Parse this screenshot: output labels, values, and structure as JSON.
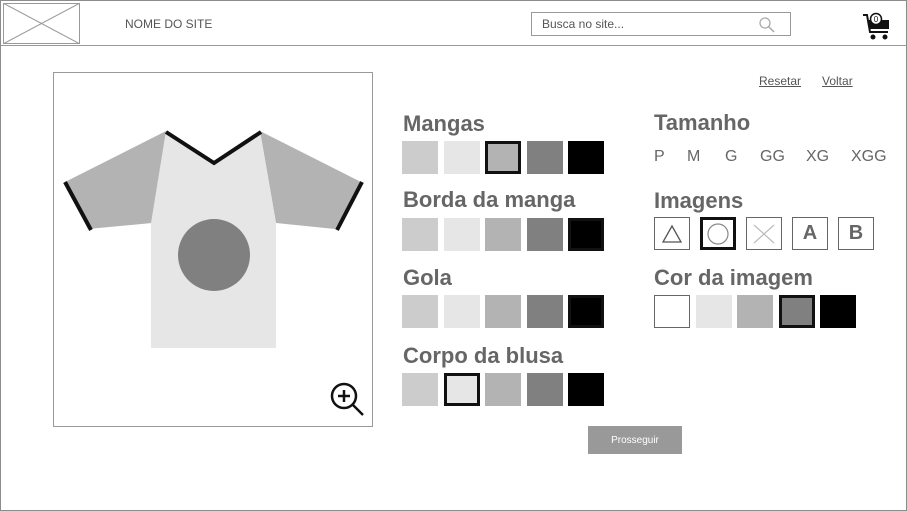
{
  "header": {
    "site_name": "NOME DO SITE",
    "search_placeholder": "Busca no site...",
    "cart_count": "0"
  },
  "links": {
    "reset": "Resetar",
    "back": "Voltar"
  },
  "preview": {
    "colors": {
      "sleeves": "#b3b3b3",
      "sleeve_border": "#111111",
      "collar": "#111111",
      "body": "#e6e6e6",
      "image": "#808080"
    }
  },
  "options": {
    "sleeves": {
      "title": "Mangas",
      "swatches": [
        "#cccccc",
        "#e6e6e6",
        "#b3b3b3",
        "#808080",
        "#000000"
      ],
      "selected": 2
    },
    "sleeve_border": {
      "title": "Borda da manga",
      "swatches": [
        "#cccccc",
        "#e6e6e6",
        "#b3b3b3",
        "#808080",
        "#000000"
      ],
      "selected": 4
    },
    "collar": {
      "title": "Gola",
      "swatches": [
        "#cccccc",
        "#e6e6e6",
        "#b3b3b3",
        "#808080",
        "#000000"
      ],
      "selected": 4
    },
    "body": {
      "title": "Corpo da blusa",
      "swatches": [
        "#cccccc",
        "#e6e6e6",
        "#b3b3b3",
        "#808080",
        "#000000"
      ],
      "selected": 1
    },
    "size": {
      "title": "Tamanho",
      "values": [
        "P",
        "M",
        "G",
        "GG",
        "XG",
        "XGG"
      ]
    },
    "images": {
      "title": "Imagens",
      "items": [
        {
          "icon": "triangle-icon",
          "label": ""
        },
        {
          "icon": "circle-icon",
          "label": ""
        },
        {
          "icon": "x-icon",
          "label": ""
        },
        {
          "icon": "letter-a",
          "label": "A"
        },
        {
          "icon": "letter-b",
          "label": "B"
        }
      ],
      "selected": 1
    },
    "image_color": {
      "title": "Cor da imagem",
      "swatches": [
        "#ffffff",
        "#e6e6e6",
        "#b3b3b3",
        "#808080",
        "#000000"
      ],
      "selected": 3
    }
  },
  "proceed_label": "Prosseguir"
}
